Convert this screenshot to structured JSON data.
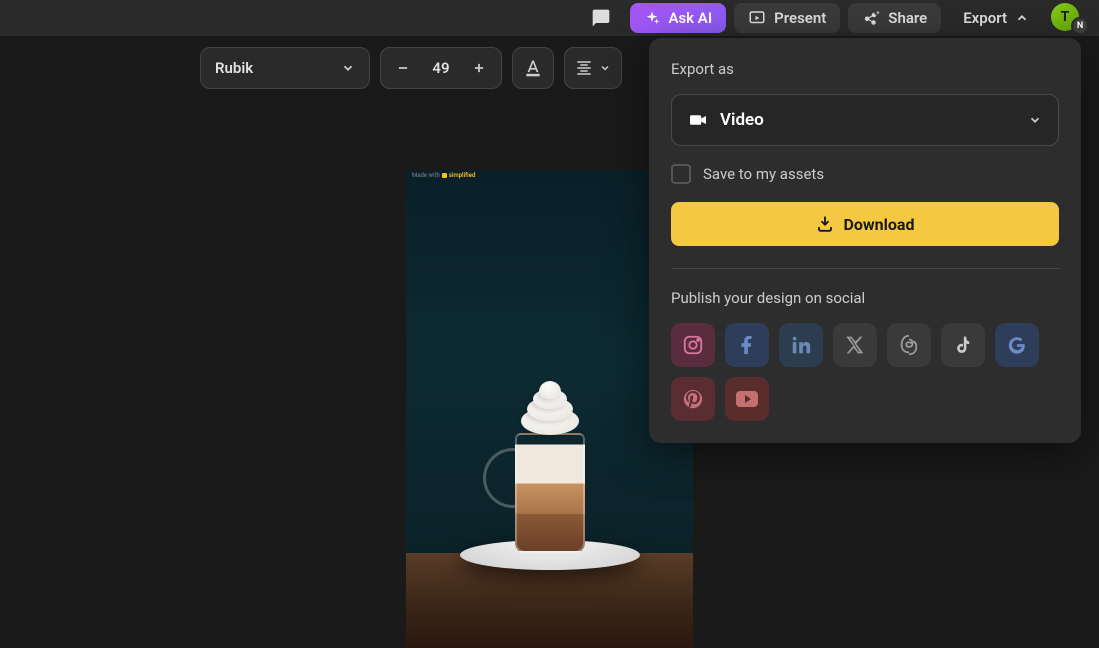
{
  "topbar": {
    "ask_ai": "Ask AI",
    "present": "Present",
    "share": "Share",
    "export": "Export",
    "avatar_initial": "T",
    "avatar_badge": "N"
  },
  "toolbar": {
    "font_name": "Rubik",
    "font_size": "49"
  },
  "canvas": {
    "watermark": "Made with",
    "watermark_brand": "simplified"
  },
  "export_panel": {
    "title": "Export as",
    "format": "Video",
    "save_assets": "Save to my assets",
    "download": "Download",
    "publish_title": "Publish your design on social"
  },
  "social": {
    "instagram": "instagram",
    "facebook": "facebook",
    "linkedin": "linkedin",
    "x": "x",
    "threads": "threads",
    "tiktok": "tiktok",
    "google": "google",
    "pinterest": "pinterest",
    "youtube": "youtube"
  }
}
